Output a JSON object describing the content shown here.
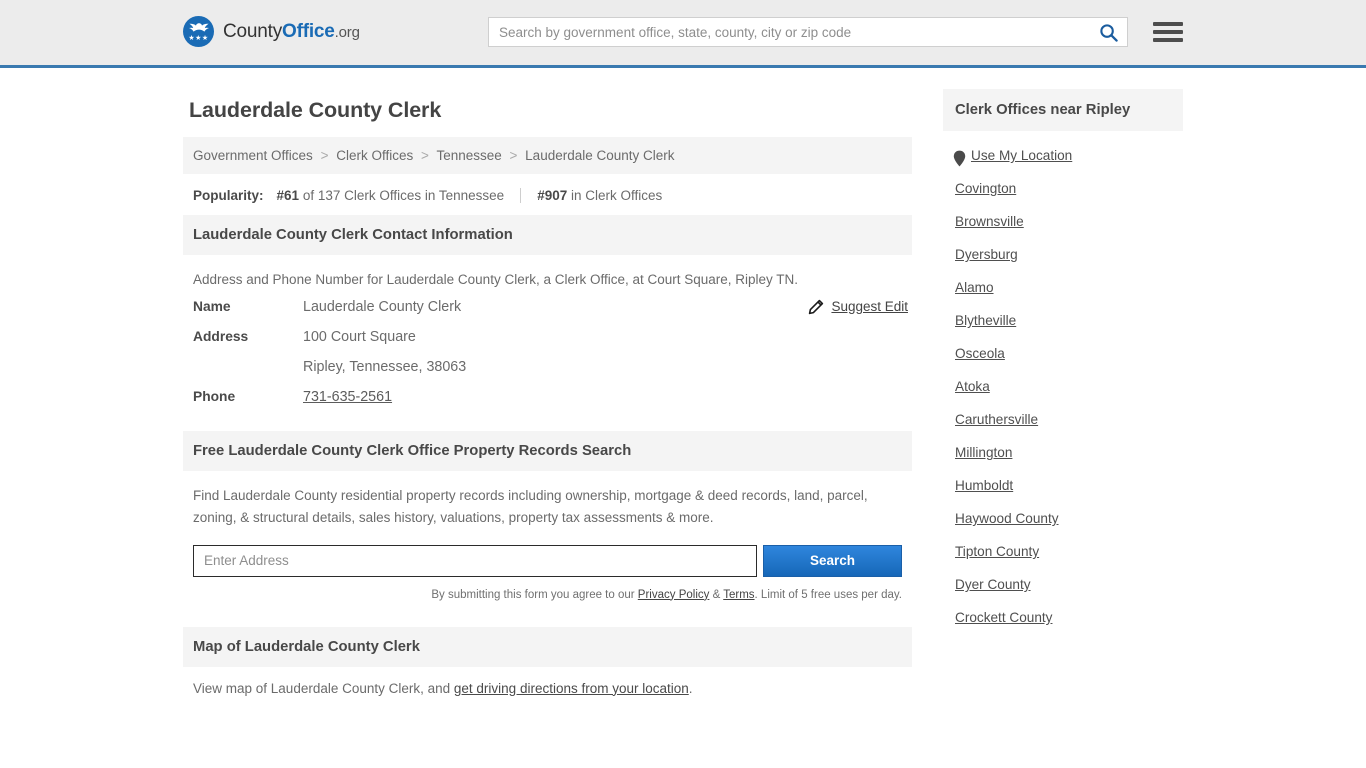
{
  "header": {
    "logo": {
      "county": "County",
      "office": "Office",
      "org": ".org",
      "stars": "★★★",
      "icon": "eagle-shield-icon"
    },
    "search": {
      "placeholder": "Search by government office, state, county, city or zip code",
      "value": "",
      "icon": "search-icon"
    },
    "menu_icon": "hamburger-menu-icon"
  },
  "main": {
    "title": "Lauderdale County Clerk",
    "breadcrumb": [
      "Government Offices",
      "Clerk Offices",
      "Tennessee",
      "Lauderdale County Clerk"
    ],
    "breadcrumb_separator": ">",
    "popularity": {
      "label": "Popularity:",
      "state_rank": "#61",
      "state_rank_text": "of 137 Clerk Offices in Tennessee",
      "national_rank": "#907",
      "national_rank_text": "in Clerk Offices"
    },
    "contact_section": {
      "heading": "Lauderdale County Clerk Contact Information",
      "description": "Address and Phone Number for Lauderdale County Clerk, a Clerk Office, at Court Square, Ripley TN.",
      "suggest_edit": {
        "label": "Suggest Edit",
        "icon": "pencil-edit-icon"
      },
      "rows": [
        {
          "key": "Name",
          "value": "Lauderdale County Clerk",
          "link": false
        },
        {
          "key": "Address",
          "value": "100 Court Square",
          "link": false
        },
        {
          "key": "",
          "value": "Ripley, Tennessee, 38063",
          "link": false
        },
        {
          "key": "Phone",
          "value": "731-635-2561",
          "link": true
        }
      ]
    },
    "property_section": {
      "heading": "Free Lauderdale County Clerk Office Property Records Search",
      "description": "Find Lauderdale County residential property records including ownership, mortgage & deed records, land, parcel, zoning, & structural details, sales history, valuations, property tax assessments & more.",
      "address_placeholder": "Enter Address",
      "address_value": "",
      "search_button": "Search",
      "note_prefix": "By submitting this form you agree to our ",
      "note_privacy": "Privacy Policy",
      "note_amp": " & ",
      "note_terms": "Terms",
      "note_suffix": ". Limit of 5 free uses per day."
    },
    "map_section": {
      "heading": "Map of Lauderdale County Clerk",
      "text_prefix": "View map of Lauderdale County Clerk, and ",
      "link": "get driving directions from your location",
      "text_suffix": "."
    }
  },
  "sidebar": {
    "heading": "Clerk Offices near Ripley",
    "use_my_location": {
      "label": "Use My Location",
      "icon": "map-pin-icon"
    },
    "items": [
      "Covington",
      "Brownsville",
      "Dyersburg",
      "Alamo",
      "Blytheville",
      "Osceola",
      "Atoka",
      "Caruthersville",
      "Millington",
      "Humboldt",
      "Haywood County",
      "Tipton County",
      "Dyer County",
      "Crockett County"
    ]
  },
  "colors": {
    "header_bg": "#ececec",
    "header_border": "#3a7ab0",
    "brand_blue": "#1a6bb5",
    "section_bg": "#f4f4f4",
    "button_blue": "#1667b8",
    "text": "#6b6b6b"
  }
}
